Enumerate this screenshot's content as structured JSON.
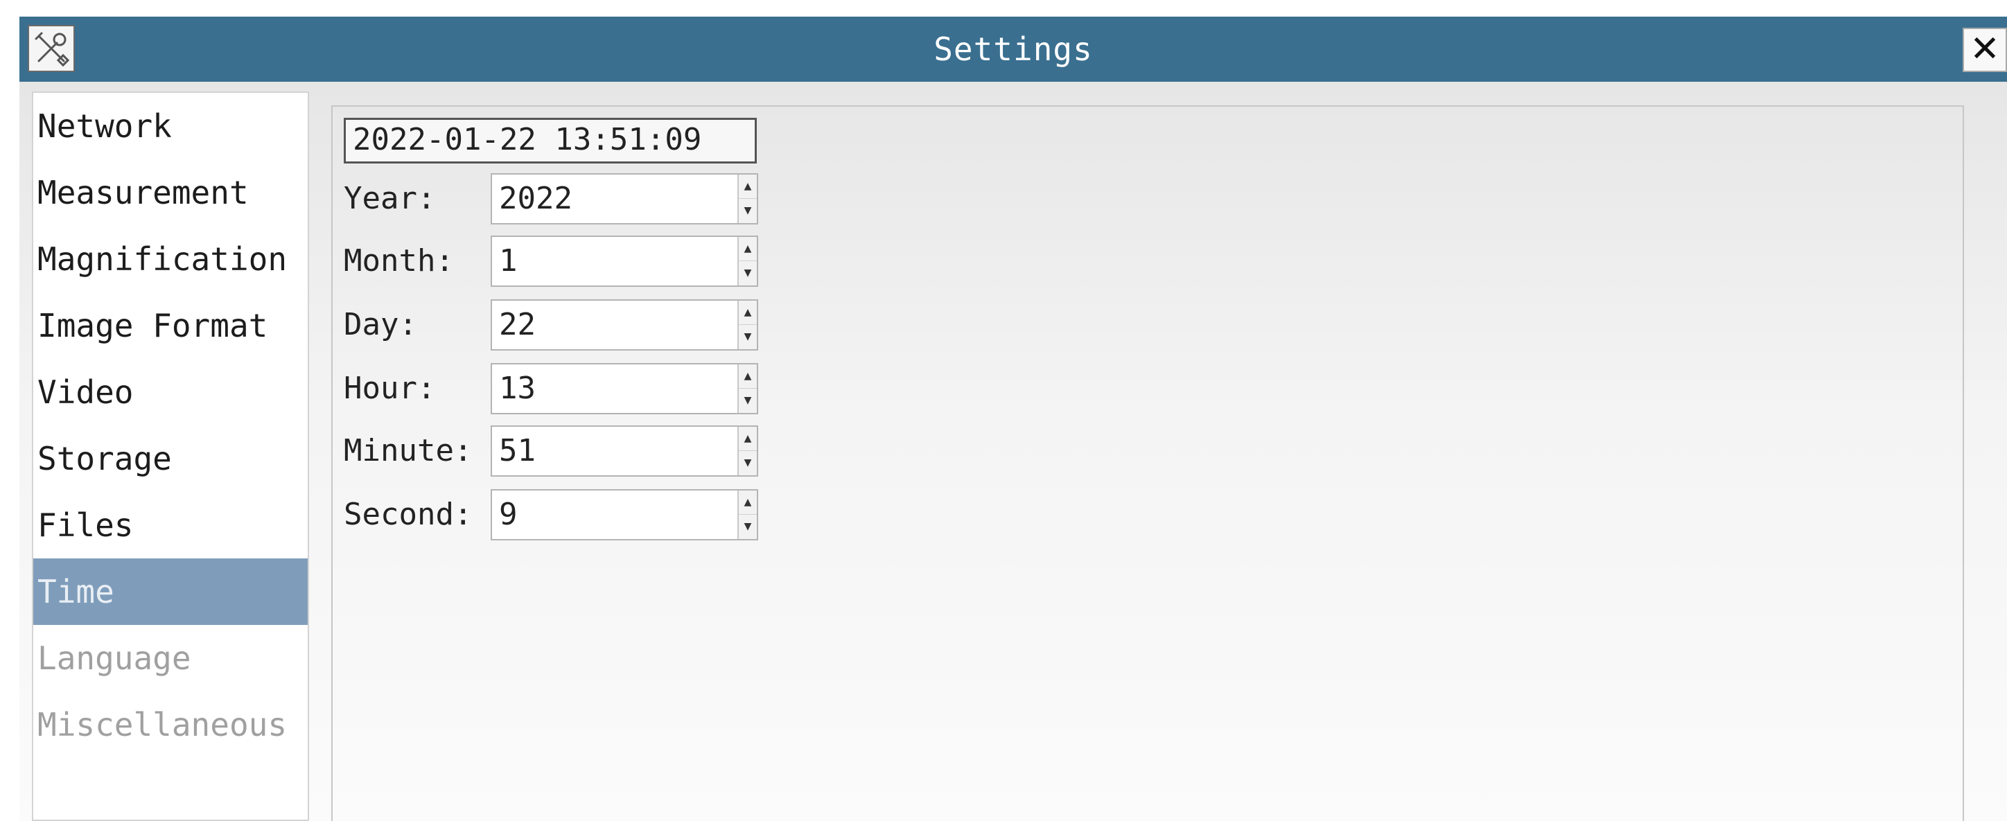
{
  "window": {
    "title": "Settings",
    "app_icon": "tools-icon",
    "close_glyph": "✕"
  },
  "sidebar": {
    "items": [
      {
        "label": "Network",
        "state": "normal"
      },
      {
        "label": "Measurement",
        "state": "normal"
      },
      {
        "label": "Magnification",
        "state": "normal"
      },
      {
        "label": "Image Format",
        "state": "normal"
      },
      {
        "label": "Video",
        "state": "normal"
      },
      {
        "label": "Storage",
        "state": "normal"
      },
      {
        "label": "Files",
        "state": "normal"
      },
      {
        "label": "Time",
        "state": "selected"
      },
      {
        "label": "Language",
        "state": "dim"
      },
      {
        "label": "Miscellaneous",
        "state": "dim"
      }
    ]
  },
  "time_panel": {
    "current_datetime": "2022-01-22 13:51:09",
    "fields": [
      {
        "label": "Year:",
        "value": "2022"
      },
      {
        "label": "Month:",
        "value": "1"
      },
      {
        "label": "Day:",
        "value": "22"
      },
      {
        "label": "Hour:",
        "value": "13"
      },
      {
        "label": "Minute:",
        "value": "51"
      },
      {
        "label": "Second:",
        "value": "9"
      }
    ],
    "spin_up_glyph": "▲",
    "spin_down_glyph": "▼"
  },
  "colors": {
    "titlebar": "#3a6f8f",
    "selected_item": "#7f9dbb"
  }
}
